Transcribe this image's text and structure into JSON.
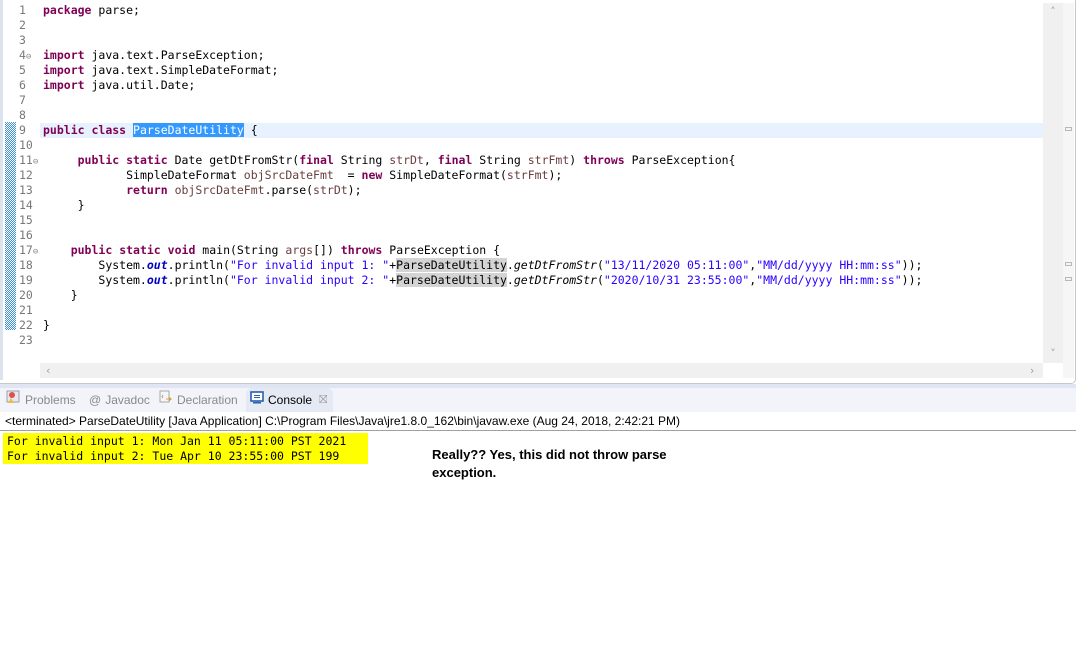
{
  "editor": {
    "line_numbers": [
      "1",
      "2",
      "3",
      "4",
      "5",
      "6",
      "7",
      "8",
      "9",
      "10",
      "11",
      "12",
      "13",
      "14",
      "15",
      "16",
      "17",
      "18",
      "19",
      "20",
      "21",
      "22",
      "23"
    ],
    "folded_lines": [
      "4",
      "11",
      "17"
    ],
    "code": {
      "l1": {
        "kw": "package",
        "rest": " parse;"
      },
      "l4": {
        "kw": "import",
        "rest": " java.text.ParseException;"
      },
      "l5": {
        "kw": "import",
        "rest": " java.text.SimpleDateFormat;"
      },
      "l6": {
        "kw": "import",
        "rest": " java.util.Date;"
      },
      "l9": {
        "kw1": "public",
        "kw2": "class",
        "selected": "ParseDateUtility",
        "rest": " {"
      },
      "l11": {
        "kw1": "public",
        "kw2": "static",
        "t1": " Date getDtFromStr(",
        "kw3": "final",
        "t2": " String ",
        "v1": "strDt",
        "t3": ", ",
        "kw4": "final",
        "t4": " String ",
        "v2": "strFmt",
        "t5": ") ",
        "kw5": "throws",
        "t6": " ParseException{"
      },
      "l12": {
        "t1": "SimpleDateFormat ",
        "v1": "objSrcDateFmt",
        "t2": "  = ",
        "kw": "new",
        "t3": " SimpleDateFormat(",
        "v2": "strFmt",
        "t4": ");"
      },
      "l13": {
        "kw": "return",
        "v1": " objSrcDateFmt",
        "t1": ".parse(",
        "v2": "strDt",
        "t2": ");"
      },
      "l14": {
        "t1": "}"
      },
      "l17": {
        "kw1": "public",
        "kw2": "static",
        "kw3": "void",
        "t1": " main(String ",
        "v1": "args",
        "t2": "[]) ",
        "kw4": "throws",
        "t3": " ParseException {"
      },
      "l18": {
        "t1": "System.",
        "field": "out",
        "t2": ".println(",
        "s1": "\"For invalid input 1: \"",
        "t3": "+",
        "occ": "ParseDateUtility",
        "t4": ".",
        "method": "getDtFromStr",
        "t5": "(",
        "s2": "\"13/11/2020 05:11:00\"",
        "t6": ",",
        "s3": "\"MM/dd/yyyy HH:mm:ss\"",
        "t7": "));"
      },
      "l19": {
        "t1": "System.",
        "field": "out",
        "t2": ".println(",
        "s1": "\"For invalid input 2: \"",
        "t3": "+",
        "occ": "ParseDateUtility",
        "t4": ".",
        "method": "getDtFromStr",
        "t5": "(",
        "s2": "\"2020/10/31 23:55:00\"",
        "t6": ",",
        "s3": "\"MM/dd/yyyy HH:mm:ss\"",
        "t7": "));"
      },
      "l20": {
        "t1": "}"
      },
      "l22": {
        "t1": "}"
      }
    },
    "scroll_up_icon": "chevron-up",
    "scroll_down_icon": "chevron-down",
    "scroll_left_icon": "chevron-left",
    "scroll_right_icon": "chevron-right"
  },
  "views": {
    "tabs": [
      {
        "label": "Problems",
        "icon": "problems-icon",
        "active": false
      },
      {
        "label": "Javadoc",
        "icon": "at-icon",
        "active": false
      },
      {
        "label": "Declaration",
        "icon": "declaration-icon",
        "active": false
      },
      {
        "label": "Console",
        "icon": "console-icon",
        "active": true
      }
    ],
    "close_glyph": "⛝"
  },
  "console": {
    "status": "<terminated> ParseDateUtility [Java Application] C:\\Program Files\\Java\\jre1.8.0_162\\bin\\javaw.exe (Aug 24, 2018, 2:42:21 PM)",
    "output": [
      "For invalid input 1: Mon Jan 11 05:11:00 PST 2021",
      "For invalid input 2: Tue Apr 10 23:55:00 PST 199"
    ],
    "highlight_color": "#ffff00"
  },
  "annotation": {
    "text": "Really??  Yes, this did not throw parse exception."
  },
  "colors": {
    "keyword": "#7f0055",
    "string": "#2a00ff",
    "local_variable": "#6a3e3e",
    "static_field": "#0000c0",
    "selection": "#3399ff",
    "current_line": "#e8f2fe"
  }
}
